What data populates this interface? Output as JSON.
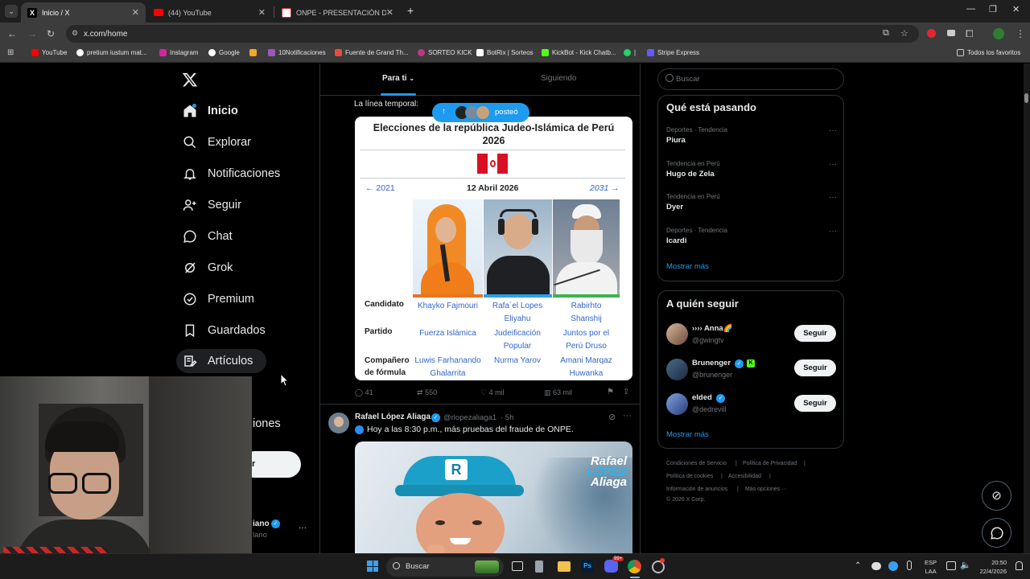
{
  "browser": {
    "tabs": [
      {
        "title": "Inicio / X",
        "active": true
      },
      {
        "title": "(44) YouTube",
        "active": false
      },
      {
        "title": "ONPE - PRESENTACIÓN DE RES",
        "active": false
      }
    ],
    "new_tab": "+",
    "url": "x.com/home",
    "bookmarks": [
      "YouTube",
      "pretium iustum mat...",
      "Instagram",
      "Google",
      "10Notificaciones",
      "Fuente de Grand Th...",
      "SORTEO KICK",
      "BotRix | Sorteos",
      "KickBot - Kick Chatb...",
      "|",
      "Stripe Express"
    ],
    "all_bookmarks": "Todos los favoritos"
  },
  "nav": {
    "items": [
      "Inicio",
      "Explorar",
      "Notificaciones",
      "Seguir",
      "Chat",
      "Grok",
      "Premium",
      "Guardados",
      "Artículos"
    ],
    "partial_more": "iones",
    "post_button": "r",
    "account_partial": "iano",
    "account_handle_partial": "lano",
    "more_dots": "···"
  },
  "timeline": {
    "tabs": [
      "Para ti",
      "Siguiendo"
    ],
    "active_tab": "Para ti",
    "new_posts_label": "posteó",
    "quote_text": "La línea temporal:",
    "wiki_card": {
      "title_line1": "Elecciones de la república Judeo-Islámica de Perú",
      "title_line2": "2026",
      "prev": "← 2021",
      "date": "12 Abril 2026",
      "next": "2031 →",
      "row_candidato": "Candidato",
      "row_partido": "Partido",
      "row_companero_1": "Compañero",
      "row_companero_2": "de fórmula",
      "candidates": [
        {
          "name_1": "Khayko Fajmouri",
          "name_2": "",
          "party_1": "Fuerza Islámica",
          "party_2": "",
          "mate_1": "Luwis Farhanando",
          "mate_2": "Ghalarrita",
          "color": "#e8741f"
        },
        {
          "name_1": "Rafa´el Lopes",
          "name_2": "Eliyahu",
          "party_1": "Judeificación",
          "party_2": "Popular",
          "mate_1": "Nurma Yarov",
          "mate_2": "",
          "color": "#2ea0e6"
        },
        {
          "name_1": "Rabirhto",
          "name_2": "Shanshij",
          "party_1": "Juntos por el",
          "party_2": "Perú Druso",
          "mate_1": "Amani Marqaz",
          "mate_2": "Huwanka",
          "color": "#3cb44b"
        }
      ]
    },
    "actions": {
      "replies": "41",
      "reposts": "550",
      "likes": "4 mil",
      "views": "63 mil"
    },
    "post2": {
      "author": "Rafael López Aliaga",
      "handle": "@rlopezaliaga1",
      "time": "· 5h",
      "text": "Hoy a las 8:30 p.m., más pruebas del fraude de ONPE.",
      "image_title_1": "Rafael",
      "image_title_2": "LÓPEZ",
      "image_title_3": "Aliaga",
      "cap_letter": "R"
    }
  },
  "right": {
    "search_placeholder": "Buscar",
    "trends_title": "Qué está pasando",
    "trends": [
      {
        "category": "Deportes · Tendencia",
        "name": "Piura"
      },
      {
        "category": "Tendencia en Perú",
        "name": "Hugo de Zela"
      },
      {
        "category": "Tendencia en Perú",
        "name": "Dyer"
      },
      {
        "category": "Deportes · Tendencia",
        "name": "Icardi"
      }
    ],
    "show_more": "Mostrar más",
    "follow_title": "A quién seguir",
    "follow": [
      {
        "name": "›››› Anna🌈",
        "handle": "@gwingtv"
      },
      {
        "name": "Brunenger",
        "handle": "@brunenger"
      },
      {
        "name": "elded",
        "handle": "@dedrevill"
      }
    ],
    "follow_label": "Seguir",
    "footer": [
      "Condiciones de Servicio",
      "Política de Privacidad",
      "Política de cookies",
      "Accesibilidad",
      "Información de anuncios",
      "Más opciones ···",
      "© 2026 X Corp."
    ]
  },
  "taskbar": {
    "search": "Buscar",
    "lang_1": "ESP",
    "lang_2": "LAA",
    "time": "20:50",
    "date": "22/4/2026",
    "badge": "99+"
  }
}
